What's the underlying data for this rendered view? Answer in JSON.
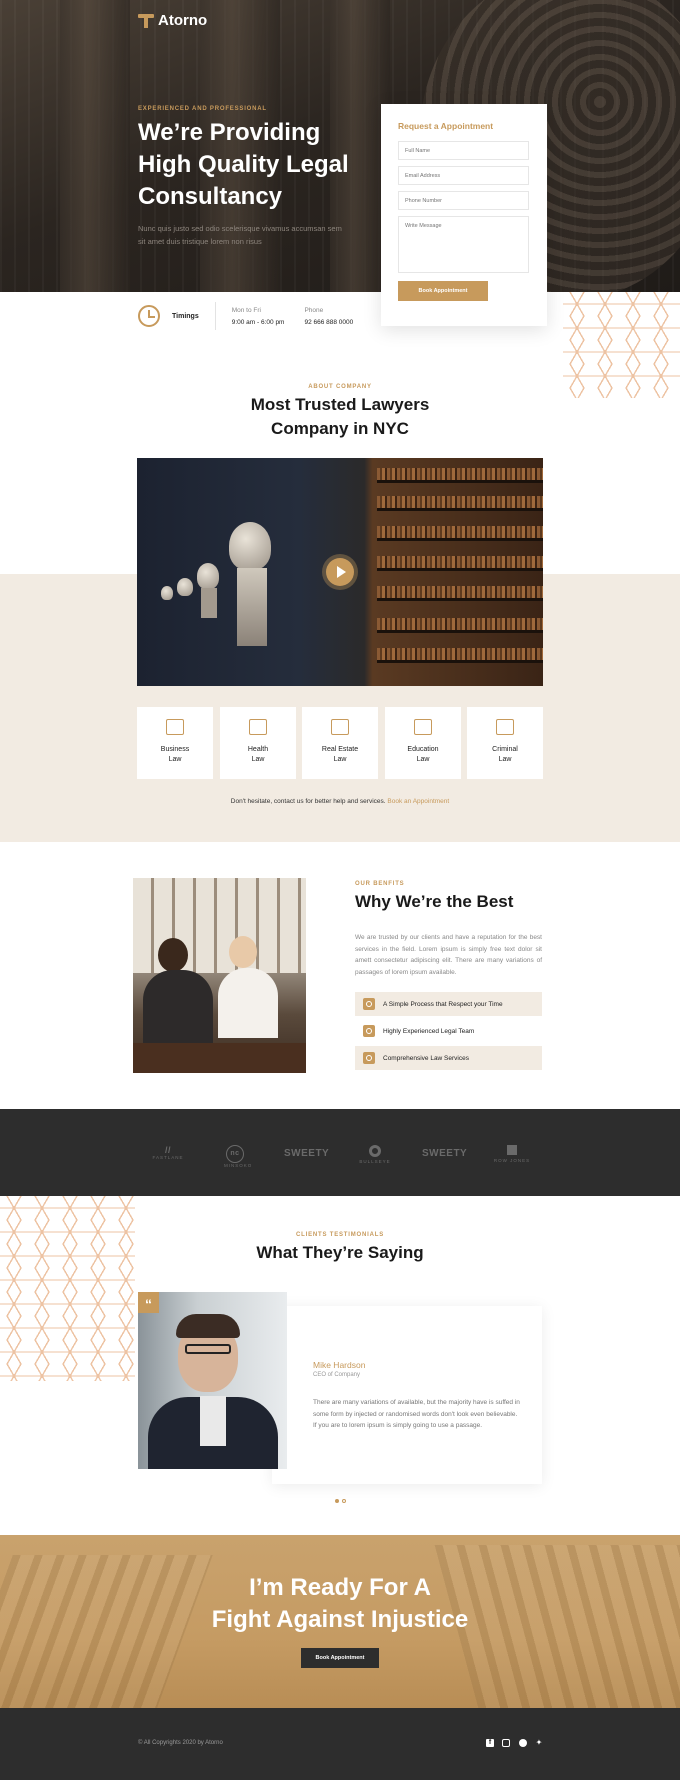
{
  "brand": {
    "name": "Atorno"
  },
  "hero": {
    "eyebrow": "EXPERIENCED AND PROFESSIONAL",
    "title": "We’re Providing High Quality Legal Consultancy",
    "subtitle": "Nunc quis justo sed odio scelerisque vivamus accumsan sem sit amet duis tristique lorem non risus"
  },
  "appointment": {
    "title": "Request a Appointment",
    "full_name_placeholder": "Full Name",
    "email_placeholder": "Email Address",
    "phone_placeholder": "Phone Number",
    "message_placeholder": "Write Message",
    "button": "Book Appointment"
  },
  "timings": {
    "label": "Timings",
    "days_label": "Mon to Fri",
    "hours": "9:00 am - 6:00 pm",
    "phone_label": "Phone",
    "phone": "92 666 888 0000"
  },
  "about": {
    "eyebrow": "ABOUT COMPANY",
    "title_line1": "Most Trusted Lawyers",
    "title_line2": "Company in NYC",
    "services": [
      {
        "line1": "Business",
        "line2": "Law",
        "icon": "briefcase-icon"
      },
      {
        "line1": "Health",
        "line2": "Law",
        "icon": "medical-kit-icon"
      },
      {
        "line1": "Real Estate",
        "line2": "Law",
        "icon": "house-icon"
      },
      {
        "line1": "Education",
        "line2": "Law",
        "icon": "book-icon"
      },
      {
        "line1": "Criminal",
        "line2": "Law",
        "icon": "scales-icon"
      }
    ],
    "cta_text": "Don't hesitate, contact us for better help and services.",
    "cta_link": "Book an Appointment"
  },
  "benefits": {
    "eyebrow": "OUR BENFITS",
    "title": "Why We’re the Best",
    "body": "We are trusted by our clients and have a reputation for the best services in the field. Lorem ipsum is simply free text dolor sit amett consectetur adipiscing elit. There are many variations of passages of lorem ipsum available.",
    "items": [
      "A Simple Process that Respect your Time",
      "Highly Experienced Legal Team",
      "Comprehensive Law Services"
    ]
  },
  "brands": [
    {
      "name": "FASTLANE",
      "sub": ""
    },
    {
      "name": "nc",
      "sub": "MINSOKO"
    },
    {
      "name": "SWEETY",
      "sub": ""
    },
    {
      "name": "",
      "sub": "BULLSEYE"
    },
    {
      "name": "SWEETY",
      "sub": ""
    },
    {
      "name": "",
      "sub": "ROW JONES"
    }
  ],
  "testimonials": {
    "eyebrow": "CLIENTS TESTIMONIALS",
    "title": "What They’re Saying",
    "quote_mark": "“",
    "name": "Mike Hardson",
    "role": "CEO of Company",
    "text": "There are many variations of available, but the majority have is suffed in some form by injected or randomised words don't look even believable. If you are to lorem ipsum is simply going to use a passage."
  },
  "banner": {
    "title_line1": "I’m Ready For A",
    "title_line2": "Fight Against Injustice",
    "button": "Book Appointment"
  },
  "footer": {
    "copyright": "© All Copyrights 2020 by Atorno",
    "social": [
      "facebook-icon",
      "instagram-icon",
      "pinterest-icon",
      "twitter-icon"
    ]
  },
  "colors": {
    "accent": "#c79a5c",
    "dark": "#2d2d2d",
    "beige": "#f2ebe2"
  }
}
